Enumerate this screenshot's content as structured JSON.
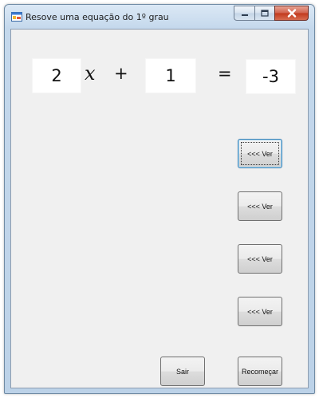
{
  "window": {
    "title": "Resove uma equação do 1º grau",
    "icon": "app-form-icon",
    "caption_buttons": [
      "minimize-icon",
      "maximize-icon",
      "close-icon"
    ]
  },
  "equation": {
    "coefficient": "2",
    "variable": "𝑥",
    "plus": "+",
    "constant": "1",
    "equals": "=",
    "result": "-3"
  },
  "buttons": {
    "ver_1": "<<< Ver",
    "ver_2": "<<< Ver",
    "ver_3": "<<< Ver",
    "ver_4": "<<< Ver",
    "sair": "Sair",
    "recomecar": "Recomeçar"
  },
  "colors": {
    "close_button": "#c2391c",
    "focus_border": "#3c7fb1"
  }
}
